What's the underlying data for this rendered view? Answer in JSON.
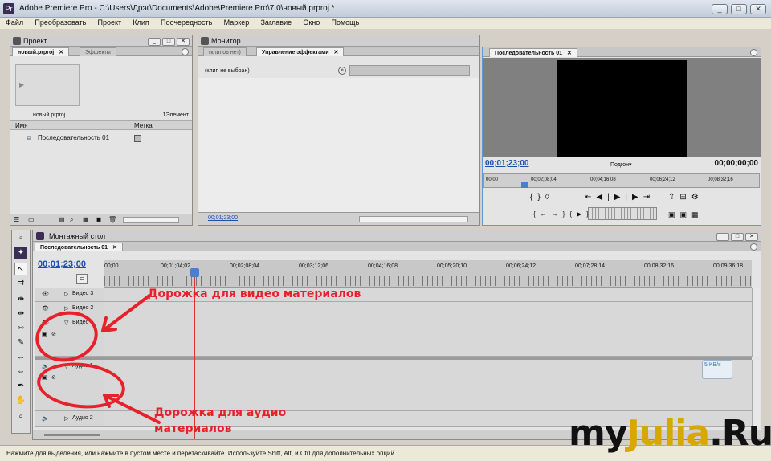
{
  "window": {
    "title": "Adobe Premiere Pro - C:\\Users\\Дрэг\\Documents\\Adobe\\Premiere Pro\\7.0\\новый.prproj *",
    "minimize": "_",
    "maximize": "□",
    "close": "✕"
  },
  "menu": [
    "Файл",
    "Преобразовать",
    "Проект",
    "Клип",
    "Поочередность",
    "Маркер",
    "Заглавие",
    "Окно",
    "Помощь"
  ],
  "project_panel": {
    "title": "Проект",
    "tabs": [
      "новый.prproj",
      "Эффекты"
    ],
    "file_name": "новый.prproj",
    "count": "1Элемент",
    "col_name": "Имя",
    "col_label": "Метка",
    "item": "Последовательность 01"
  },
  "monitor_panel": {
    "title": "Монитор",
    "tabs": [
      "(клипов нет)",
      "Управление эффектами"
    ],
    "no_clip": "(клип не выбран)",
    "timecode": "00;01;23;00"
  },
  "program_panel": {
    "tab": "Последовательность 01",
    "tc_left": "00;01;23;00",
    "fit": "Подгон",
    "tc_right": "00;00;00;00",
    "ruler": [
      "00;00",
      "00;02;08;04",
      "00;04;16;08",
      "00;06;24;12",
      "00;08;32;16"
    ]
  },
  "timeline": {
    "title": "Монтажный стол",
    "tab": "Последовательность 01",
    "timecode": "00;01;23;00",
    "ruler": [
      "00;00",
      "00;01;04;02",
      "00;02;08;04",
      "00;03;12;06",
      "00;04;16;08",
      "00;05;20;10",
      "00;06;24;12",
      "00;07;28;14",
      "00;08;32;16",
      "00;09;36;18"
    ],
    "tracks": [
      "Видео 3",
      "Видео 2",
      "Видео 1",
      "Аудио 1",
      "Аудио 2"
    ]
  },
  "annotations": {
    "video": "Дорожка для видео материалов",
    "audio_line1": "Дорожка для аудио",
    "audio_line2": "материалов"
  },
  "net_badge": "5 KB/s",
  "status": "Нажмите для выделения, или нажмите в пустом месте и перетаскивайте. Используйте Shift, Alt, и Ctrl для дополнительных опций.",
  "watermark": {
    "a": "my",
    "b": "Julia",
    "c": ".Ru"
  },
  "colors": {
    "annotation": "#e8202a",
    "timecode_blue": "#1c4fa8",
    "watermark_gold": "#d9a800"
  }
}
